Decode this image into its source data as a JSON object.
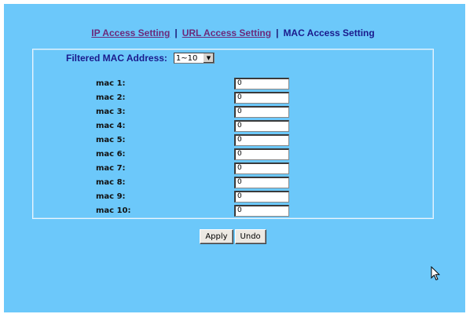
{
  "topnav": {
    "ip_link": "IP Access Setting",
    "url_link": "URL Access Setting",
    "mac_current": "MAC Access Setting",
    "separator": "|"
  },
  "filter": {
    "label": "Filtered MAC Address:",
    "selected": "1~10",
    "dropdown_icon": "triangle-down-icon"
  },
  "mac_entries": [
    {
      "label": "mac 1:",
      "value": "0"
    },
    {
      "label": "mac 2:",
      "value": "0"
    },
    {
      "label": "mac 3:",
      "value": "0"
    },
    {
      "label": "mac 4:",
      "value": "0"
    },
    {
      "label": "mac 5:",
      "value": "0"
    },
    {
      "label": "mac 6:",
      "value": "0"
    },
    {
      "label": "mac 7:",
      "value": "0"
    },
    {
      "label": "mac 8:",
      "value": "0"
    },
    {
      "label": "mac 9:",
      "value": "0"
    },
    {
      "label": "mac 10:",
      "value": "0"
    }
  ],
  "actions": {
    "apply": "Apply",
    "undo": "Undo"
  },
  "colors": {
    "background": "#6cc8fa",
    "link": "#6b2a7b",
    "heading": "#1a1a8c"
  },
  "cursor_icon": "mouse-pointer-icon"
}
